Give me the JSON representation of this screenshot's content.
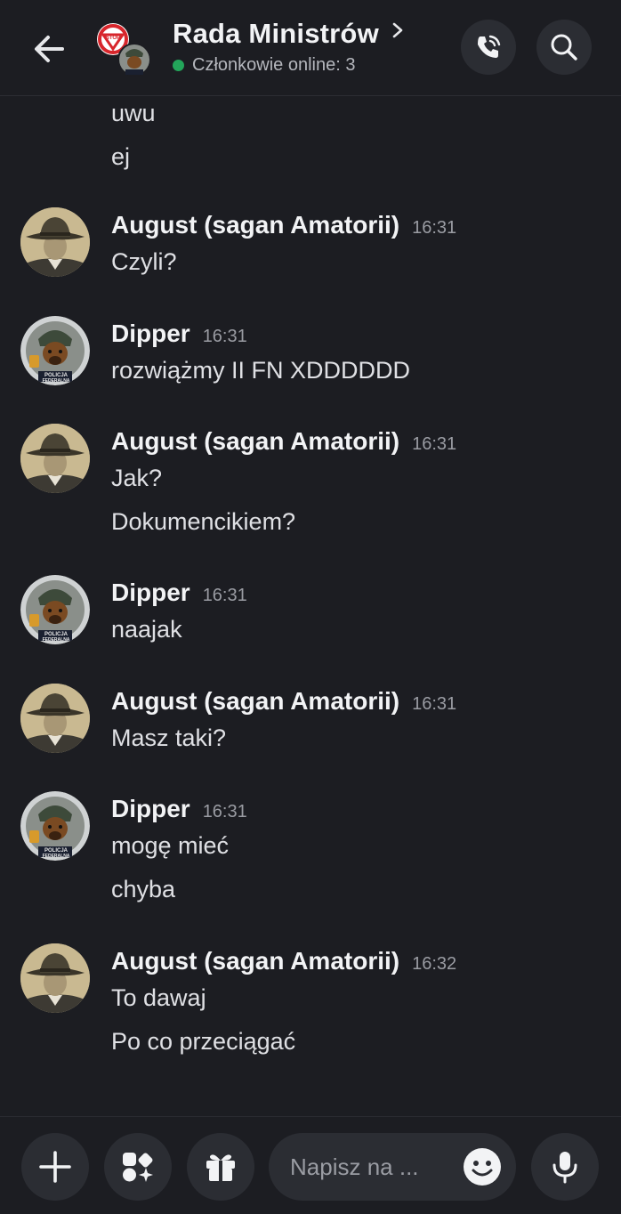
{
  "header": {
    "title": "Rada Ministrów",
    "online_label": "Członkowie online: 3",
    "group_stop_sign_text": "STOP",
    "status_color": "#23a55a"
  },
  "messages": {
    "continuation": [
      "uwu",
      "ej"
    ],
    "groups": [
      {
        "author": "August (sagan Amatorii)",
        "time": "16:31",
        "lines": [
          "Czyli?"
        ],
        "avatar": "august-avatar"
      },
      {
        "author": "Dipper",
        "time": "16:31",
        "lines": [
          "rozwiążmy II FN XDDDDDD"
        ],
        "avatar": "dipper-avatar"
      },
      {
        "author": "August (sagan Amatorii)",
        "time": "16:31",
        "lines": [
          "Jak?",
          "Dokumencikiem?"
        ],
        "avatar": "august-avatar"
      },
      {
        "author": "Dipper",
        "time": "16:31",
        "lines": [
          "naajak"
        ],
        "avatar": "dipper-avatar"
      },
      {
        "author": "August (sagan Amatorii)",
        "time": "16:31",
        "lines": [
          "Masz taki?"
        ],
        "avatar": "august-avatar"
      },
      {
        "author": "Dipper",
        "time": "16:31",
        "lines": [
          "mogę mieć",
          "chyba"
        ],
        "avatar": "dipper-avatar"
      },
      {
        "author": "August (sagan Amatorii)",
        "time": "16:32",
        "lines": [
          "To dawaj",
          "Po co przeciągać"
        ],
        "avatar": "august-avatar"
      }
    ],
    "dipper_badge_text": [
      "POLICJA",
      "FEDERALNA"
    ]
  },
  "composer": {
    "placeholder": "Napisz na ..."
  },
  "icons": {
    "back": "arrow-left-icon",
    "call": "phone-call-icon",
    "search": "search-icon",
    "plus": "plus-icon",
    "apps": "apps-icon",
    "gift": "gift-icon",
    "emoji": "emoji-icon",
    "mic": "microphone-icon"
  }
}
